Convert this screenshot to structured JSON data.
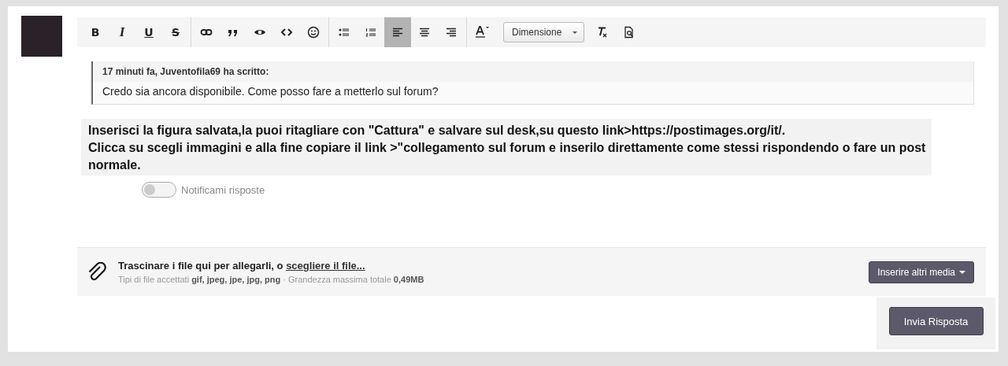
{
  "toolbar": {
    "groups": [
      [
        {
          "kind": "bold",
          "label": "B",
          "selected": false
        },
        {
          "kind": "italic",
          "label": "I",
          "selected": false
        },
        {
          "kind": "underline",
          "label": "U",
          "selected": false
        },
        {
          "kind": "strike",
          "label": "S",
          "selected": false
        }
      ],
      [
        {
          "kind": "link",
          "selected": false
        },
        {
          "kind": "quote",
          "selected": false
        },
        {
          "kind": "eye",
          "selected": false
        },
        {
          "kind": "code",
          "selected": false
        },
        {
          "kind": "smiley",
          "selected": false
        }
      ],
      [
        {
          "kind": "bullets",
          "selected": false
        },
        {
          "kind": "numbers",
          "selected": false
        },
        {
          "kind": "align-left",
          "selected": true
        },
        {
          "kind": "align-center",
          "selected": false
        },
        {
          "kind": "align-right",
          "selected": false
        }
      ],
      [
        {
          "kind": "text-color",
          "selected": false
        }
      ]
    ],
    "size_dropdown": "Dimensione",
    "tail": [
      {
        "kind": "clear-format"
      },
      {
        "kind": "preview"
      }
    ]
  },
  "quote": {
    "header": "17 minuti fa, Juventofila69 ha scritto:",
    "body": "Credo sia ancora disponibile. Come posso fare a metterlo sul forum?"
  },
  "pasted_text": [
    "Inserisci la figura salvata,la puoi ritagliare con \"Cattura\" e salvare sul desk,su questo link>https://postimages.org/it/.",
    "Clicca su scegli immagini e alla fine copiare il link >\"collegamento sul forum e inserilo direttamente come stessi rispondendo o fare un post normale."
  ],
  "notify_toggle": {
    "label": "Notificami risposte",
    "on": false
  },
  "attach": {
    "prompt": "Trascinare i file qui per allegarli, o ",
    "link": "scegliere il file...",
    "info": "Tipi di file accettati **gif, jpeg, jpe, jpg, png** · Grandezza massima totale **0,49MB**",
    "media_button": "Inserire altri media"
  },
  "submit_button": "Invia Risposta"
}
